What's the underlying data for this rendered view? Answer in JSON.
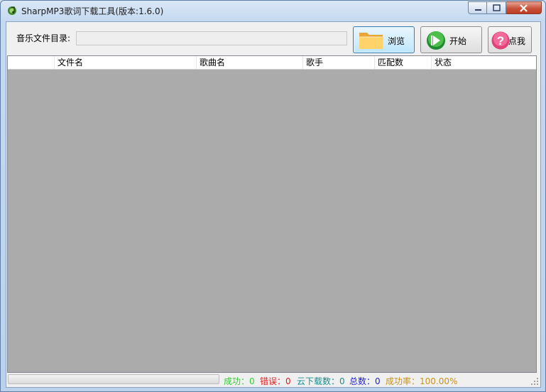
{
  "window": {
    "title": "SharpMP3歌词下载工具(版本:1.6.0)"
  },
  "toolbar": {
    "dir_label": "音乐文件目录:",
    "dir_value": "",
    "browse_label": "浏览",
    "start_label": "开始",
    "click_label": "点我"
  },
  "table": {
    "columns": [
      "",
      "文件名",
      "歌曲名",
      "歌手",
      "匹配数",
      "状态"
    ],
    "rows": []
  },
  "status": {
    "progress": 0,
    "success": "成功：0",
    "error": "错误：0",
    "cloud": "云下载数：0",
    "total": "总数：0",
    "rate": "成功率：100.00%",
    "colors": {
      "success": "#33cc33",
      "error": "#e02020",
      "cloud": "#1a8c8c",
      "total": "#1f1fd0",
      "rate": "#c8901e"
    }
  },
  "icons": {
    "app": "music-note-icon",
    "browse": "folder-icon",
    "start": "play-icon",
    "click": "question-icon"
  }
}
